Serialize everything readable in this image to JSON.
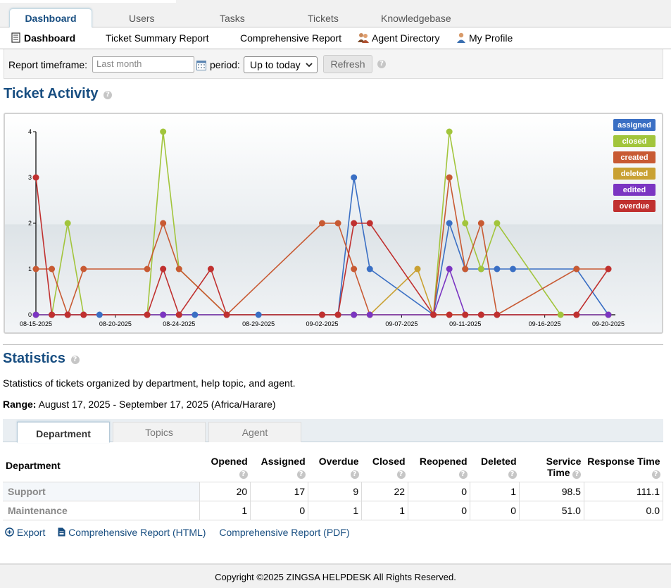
{
  "nav": {
    "tabs": [
      {
        "label": "Dashboard",
        "active": true
      },
      {
        "label": "Users"
      },
      {
        "label": "Tasks"
      },
      {
        "label": "Tickets"
      },
      {
        "label": "Knowledgebase"
      }
    ],
    "subnav": [
      {
        "label": "Dashboard",
        "icon": "dashboard-icon",
        "active": true
      },
      {
        "label": "Ticket Summary Report"
      },
      {
        "label": "Comprehensive Report"
      },
      {
        "label": "Agent Directory",
        "icon": "agents-icon"
      },
      {
        "label": "My Profile",
        "icon": "profile-icon"
      }
    ]
  },
  "filter": {
    "timeframe_label": "Report timeframe:",
    "timeframe_placeholder": "Last month",
    "period_label": "period:",
    "period_value": "Up to today",
    "refresh_label": "Refresh",
    "help_glyph": "?"
  },
  "activity": {
    "title": "Ticket Activity"
  },
  "chart_data": {
    "type": "line",
    "x": [
      "08-15-2025",
      "08-16-2025",
      "08-17-2025",
      "08-18-2025",
      "08-19-2025",
      "08-20-2025",
      "08-21-2025",
      "08-22-2025",
      "08-23-2025",
      "08-24-2025",
      "08-25-2025",
      "08-26-2025",
      "08-27-2025",
      "08-28-2025",
      "08-29-2025",
      "08-30-2025",
      "08-31-2025",
      "09-01-2025",
      "09-02-2025",
      "09-03-2025",
      "09-04-2025",
      "09-05-2025",
      "09-06-2025",
      "09-07-2025",
      "09-08-2025",
      "09-09-2025",
      "09-10-2025",
      "09-11-2025",
      "09-12-2025",
      "09-13-2025",
      "09-14-2025",
      "09-15-2025",
      "09-16-2025",
      "09-17-2025",
      "09-18-2025",
      "09-19-2025",
      "09-20-2025"
    ],
    "xtick_labels": [
      "08-15-2025",
      "08-20-2025",
      "08-24-2025",
      "08-29-2025",
      "09-02-2025",
      "09-07-2025",
      "09-11-2025",
      "09-16-2025",
      "09-20-2025"
    ],
    "ylim": [
      0,
      4
    ],
    "yticks": [
      0,
      1,
      2,
      3,
      4
    ],
    "legend_position": "top-right",
    "series": [
      {
        "name": "assigned",
        "color": "#3a6fc4",
        "points": [
          [
            "08-15-2025",
            0
          ],
          [
            "08-17-2025",
            0
          ],
          [
            "08-19-2025",
            0
          ],
          [
            "08-23-2025",
            0
          ],
          [
            "08-24-2025",
            0
          ],
          [
            "08-25-2025",
            0
          ],
          [
            "08-29-2025",
            0
          ],
          [
            "09-02-2025",
            0
          ],
          [
            "09-03-2025",
            0
          ],
          [
            "09-04-2025",
            3
          ],
          [
            "09-05-2025",
            1
          ],
          [
            "09-09-2025",
            0
          ],
          [
            "09-10-2025",
            2
          ],
          [
            "09-11-2025",
            1
          ],
          [
            "09-12-2025",
            1
          ],
          [
            "09-13-2025",
            1
          ],
          [
            "09-14-2025",
            1
          ],
          [
            "09-18-2025",
            1
          ],
          [
            "09-20-2025",
            0
          ]
        ]
      },
      {
        "name": "closed",
        "color": "#a2c53c",
        "points": [
          [
            "08-15-2025",
            0
          ],
          [
            "08-16-2025",
            0
          ],
          [
            "08-17-2025",
            2
          ],
          [
            "08-18-2025",
            0
          ],
          [
            "08-22-2025",
            0
          ],
          [
            "08-23-2025",
            4
          ],
          [
            "08-24-2025",
            1
          ],
          [
            "08-27-2025",
            0
          ],
          [
            "09-02-2025",
            0
          ],
          [
            "09-03-2025",
            0
          ],
          [
            "09-04-2025",
            0
          ],
          [
            "09-05-2025",
            0
          ],
          [
            "09-09-2025",
            0
          ],
          [
            "09-10-2025",
            4
          ],
          [
            "09-11-2025",
            2
          ],
          [
            "09-12-2025",
            1
          ],
          [
            "09-13-2025",
            2
          ],
          [
            "09-17-2025",
            0
          ],
          [
            "09-20-2025",
            0
          ]
        ]
      },
      {
        "name": "created",
        "color": "#c85a33",
        "points": [
          [
            "08-15-2025",
            1
          ],
          [
            "08-16-2025",
            1
          ],
          [
            "08-17-2025",
            0
          ],
          [
            "08-18-2025",
            1
          ],
          [
            "08-22-2025",
            1
          ],
          [
            "08-23-2025",
            2
          ],
          [
            "08-24-2025",
            1
          ],
          [
            "08-27-2025",
            0
          ],
          [
            "09-02-2025",
            2
          ],
          [
            "09-03-2025",
            2
          ],
          [
            "09-04-2025",
            1
          ],
          [
            "09-05-2025",
            0
          ],
          [
            "09-09-2025",
            0
          ],
          [
            "09-10-2025",
            3
          ],
          [
            "09-11-2025",
            1
          ],
          [
            "09-12-2025",
            2
          ],
          [
            "09-13-2025",
            0
          ],
          [
            "09-18-2025",
            1
          ],
          [
            "09-20-2025",
            1
          ]
        ]
      },
      {
        "name": "deleted",
        "color": "#c9a133",
        "points": [
          [
            "08-15-2025",
            0
          ],
          [
            "08-16-2025",
            0
          ],
          [
            "08-17-2025",
            0
          ],
          [
            "08-18-2025",
            0
          ],
          [
            "08-22-2025",
            0
          ],
          [
            "08-23-2025",
            0
          ],
          [
            "08-24-2025",
            0
          ],
          [
            "08-27-2025",
            0
          ],
          [
            "09-02-2025",
            0
          ],
          [
            "09-03-2025",
            0
          ],
          [
            "09-04-2025",
            0
          ],
          [
            "09-05-2025",
            0
          ],
          [
            "09-08-2025",
            1
          ],
          [
            "09-09-2025",
            0
          ],
          [
            "09-10-2025",
            0
          ],
          [
            "09-11-2025",
            0
          ],
          [
            "09-12-2025",
            0
          ],
          [
            "09-13-2025",
            0
          ],
          [
            "09-18-2025",
            0
          ],
          [
            "09-20-2025",
            0
          ]
        ]
      },
      {
        "name": "edited",
        "color": "#7b35c2",
        "points": [
          [
            "08-15-2025",
            0
          ],
          [
            "08-16-2025",
            0
          ],
          [
            "08-17-2025",
            0
          ],
          [
            "08-18-2025",
            0
          ],
          [
            "08-22-2025",
            0
          ],
          [
            "08-23-2025",
            0
          ],
          [
            "08-24-2025",
            0
          ],
          [
            "08-27-2025",
            0
          ],
          [
            "09-02-2025",
            0
          ],
          [
            "09-03-2025",
            0
          ],
          [
            "09-04-2025",
            0
          ],
          [
            "09-05-2025",
            0
          ],
          [
            "09-09-2025",
            0
          ],
          [
            "09-10-2025",
            1
          ],
          [
            "09-11-2025",
            0
          ],
          [
            "09-12-2025",
            0
          ],
          [
            "09-13-2025",
            0
          ],
          [
            "09-18-2025",
            0
          ],
          [
            "09-20-2025",
            0
          ]
        ]
      },
      {
        "name": "overdue",
        "color": "#c0302f",
        "points": [
          [
            "08-15-2025",
            3
          ],
          [
            "08-16-2025",
            0
          ],
          [
            "08-17-2025",
            0
          ],
          [
            "08-18-2025",
            0
          ],
          [
            "08-22-2025",
            0
          ],
          [
            "08-23-2025",
            1
          ],
          [
            "08-24-2025",
            0
          ],
          [
            "08-26-2025",
            1
          ],
          [
            "08-27-2025",
            0
          ],
          [
            "09-02-2025",
            0
          ],
          [
            "09-03-2025",
            0
          ],
          [
            "09-04-2025",
            2
          ],
          [
            "09-05-2025",
            2
          ],
          [
            "09-09-2025",
            0
          ],
          [
            "09-10-2025",
            0
          ],
          [
            "09-11-2025",
            0
          ],
          [
            "09-12-2025",
            0
          ],
          [
            "09-13-2025",
            0
          ],
          [
            "09-18-2025",
            0
          ],
          [
            "09-20-2025",
            1
          ]
        ]
      }
    ]
  },
  "statistics": {
    "title": "Statistics",
    "description": "Statistics of tickets organized by department, help topic, and agent.",
    "range_label": "Range:",
    "range_value": "August 17, 2025 - September 17, 2025 (Africa/Harare)",
    "tabs": [
      {
        "label": "Department",
        "active": true
      },
      {
        "label": "Topics"
      },
      {
        "label": "Agent"
      }
    ],
    "columns": [
      "Department",
      "Opened",
      "Assigned",
      "Overdue",
      "Closed",
      "Reopened",
      "Deleted",
      "Service Time",
      "Response Time"
    ],
    "rows": [
      {
        "name": "Support",
        "values": [
          "20",
          "17",
          "9",
          "22",
          "0",
          "1",
          "98.5",
          "111.1"
        ]
      },
      {
        "name": "Maintenance",
        "values": [
          "1",
          "0",
          "1",
          "1",
          "0",
          "0",
          "51.0",
          "0.0"
        ]
      }
    ],
    "links": {
      "export": "Export",
      "html": "Comprehensive Report (HTML)",
      "pdf": "Comprehensive Report (PDF)"
    }
  },
  "footer": {
    "copyright": "Copyright ©2025 ZINGSA HELPDESK All Rights Reserved."
  }
}
